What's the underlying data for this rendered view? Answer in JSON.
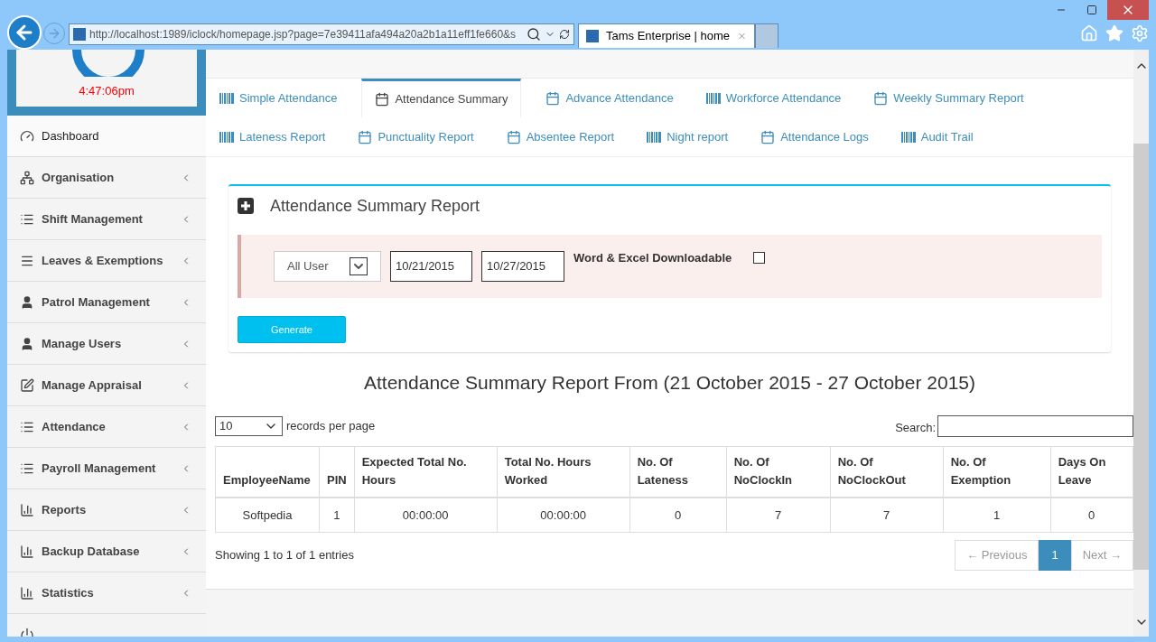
{
  "browser": {
    "address": "http://localhost:1989/iclock/homepage.jsp?page=7e39411afa494a20a2b1a11eff1fe660&s",
    "tabs": [
      {
        "title": "Tams Enterprise | home",
        "selected": true
      }
    ]
  },
  "clock": {
    "time": "4:47:06pm"
  },
  "sidebar": {
    "items": [
      {
        "label": "Dashboard",
        "selected": true,
        "has_submenu": false
      },
      {
        "label": "Organisation",
        "selected": false,
        "has_submenu": true
      },
      {
        "label": "Shift Management",
        "selected": false,
        "has_submenu": true
      },
      {
        "label": "Leaves & Exemptions",
        "selected": false,
        "has_submenu": true
      },
      {
        "label": "Patrol Management",
        "selected": false,
        "has_submenu": true
      },
      {
        "label": "Manage Users",
        "selected": false,
        "has_submenu": true
      },
      {
        "label": "Manage Appraisal",
        "selected": false,
        "has_submenu": true
      },
      {
        "label": "Attendance",
        "selected": false,
        "has_submenu": true
      },
      {
        "label": "Payroll Management",
        "selected": false,
        "has_submenu": true
      },
      {
        "label": "Reports",
        "selected": false,
        "has_submenu": true
      },
      {
        "label": "Backup Database",
        "selected": false,
        "has_submenu": true
      },
      {
        "label": "Statistics",
        "selected": false,
        "has_submenu": true
      }
    ]
  },
  "report_tabs": [
    [
      {
        "label": "Simple Attendance",
        "selected": false
      },
      {
        "label": "Attendance Summary",
        "selected": true
      },
      {
        "label": "Advance Attendance",
        "selected": false
      },
      {
        "label": "Workforce Attendance",
        "selected": false
      },
      {
        "label": "Weekly Summary Report",
        "selected": false
      }
    ],
    [
      {
        "label": "Lateness Report",
        "selected": false
      },
      {
        "label": "Punctuality Report",
        "selected": false
      },
      {
        "label": "Absentee Report",
        "selected": false
      },
      {
        "label": "Night report",
        "selected": false
      },
      {
        "label": "Attendance Logs",
        "selected": false
      },
      {
        "label": "Audit Trail",
        "selected": false
      }
    ]
  ],
  "form": {
    "title": "Attendance Summary Report",
    "user_select": "All User",
    "from_date": "10/21/2015",
    "to_date": "10/27/2015",
    "downloadable_label": "Word & Excel Downloadable",
    "downloadable": false,
    "generate": "Generate"
  },
  "report_title": "Attendance Summary Report From (21 October 2015 - 27 October 2015)",
  "table": {
    "page_size": "10",
    "page_size_label": "records per page",
    "search_label": "Search:",
    "columns": [
      "EmployeeName",
      "PIN",
      "Expected Total No. Hours",
      "Total No. Hours Worked",
      "No. Of Lateness",
      "No. Of NoClockIn",
      "No. Of NoClockOut",
      "No. Of Exemption",
      "Days On Leave"
    ],
    "rows": [
      [
        "Softpedia",
        "1",
        "00:00:00",
        "00:00:00",
        "0",
        "7",
        "7",
        "1",
        "0"
      ]
    ],
    "info": "Showing 1 to 1 of 1 entries",
    "pagination": [
      {
        "label": "← Previous",
        "kind": "nav",
        "disabled": true,
        "selected": false
      },
      {
        "label": "1",
        "kind": "page",
        "disabled": false,
        "selected": true
      },
      {
        "label": "Next →",
        "kind": "nav",
        "disabled": true,
        "selected": false
      }
    ]
  }
}
